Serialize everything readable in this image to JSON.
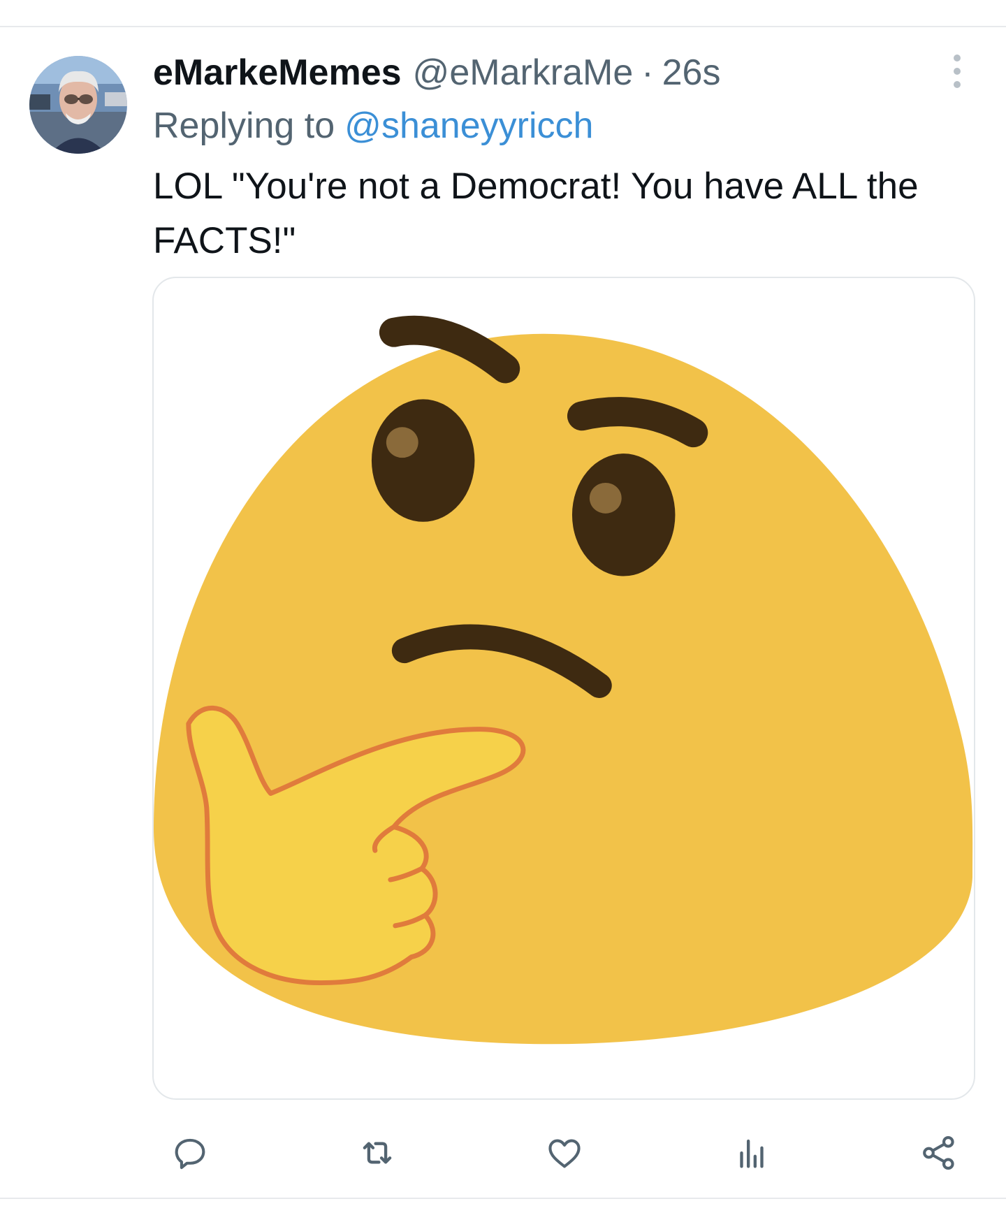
{
  "tweet": {
    "display_name": "eMarkeMemes",
    "handle": "@eMarkraMe",
    "separator": "·",
    "timestamp": "26s",
    "replying_prefix": "Replying to",
    "replying_to": "@shaneyyricch",
    "text": "LOL \"You're not a Democrat! You have ALL the FACTS!\""
  },
  "media": {
    "description_icon": "thinking-face-emoji"
  },
  "actions": [
    {
      "icon": "reply-icon"
    },
    {
      "icon": "retweet-icon"
    },
    {
      "icon": "like-icon"
    },
    {
      "icon": "views-icon"
    },
    {
      "icon": "share-icon"
    }
  ],
  "colors": {
    "text_primary": "#0f1419",
    "text_secondary": "#536471",
    "link": "#3b8fd6",
    "emoji_face": "#f2c249",
    "emoji_hand": "#f6d14a",
    "emoji_outline": "#e07b3c",
    "emoji_features": "#3e2a11"
  }
}
